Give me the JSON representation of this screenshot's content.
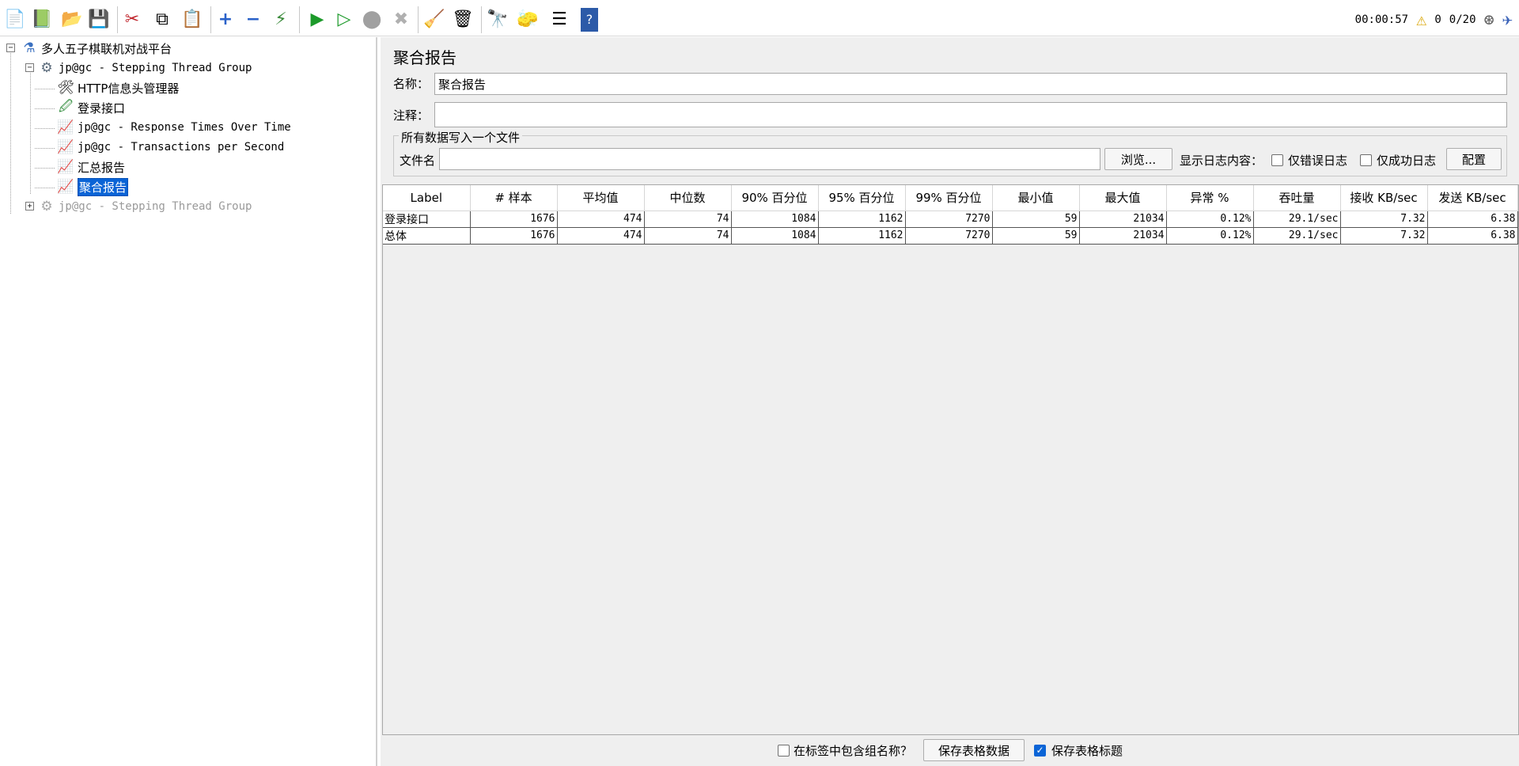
{
  "toolbar": {
    "icons": [
      "new-icon",
      "templates-icon",
      "open-icon",
      "save-icon",
      "cut-icon",
      "copy-icon",
      "paste-icon",
      "expand-icon",
      "collapse-icon",
      "toggle-icon",
      "start-icon",
      "start-no-pauses-icon",
      "stop-icon",
      "shutdown-icon",
      "clear-icon",
      "clear-all-icon",
      "search-icon",
      "reset-search-icon",
      "function-helper-icon",
      "help-icon"
    ],
    "elapsed": "00:00:57",
    "warnings": "0",
    "threads": "0/20"
  },
  "tree": {
    "root": "多人五子棋联机对战平台",
    "group1": "jp@gc - Stepping Thread Group",
    "children": [
      "HTTP信息头管理器",
      "登录接口",
      "jp@gc - Response Times Over Time",
      "jp@gc - Transactions per Second",
      "汇总报告",
      "聚合报告"
    ],
    "group2": "jp@gc - Stepping Thread Group"
  },
  "panel": {
    "title": "聚合报告",
    "name_label": "名称：",
    "name_value": "聚合报告",
    "comment_label": "注释：",
    "comment_value": "",
    "file_section_label": "所有数据写入一个文件",
    "filename_label": "文件名",
    "filename_value": "",
    "browse_label": "浏览...",
    "log_content_label": "显示日志内容：",
    "errors_only_label": "仅错误日志",
    "success_only_label": "仅成功日志",
    "configure_label": "配置"
  },
  "table": {
    "columns": [
      "Label",
      "# 样本",
      "平均值",
      "中位数",
      "90% 百分位",
      "95% 百分位",
      "99% 百分位",
      "最小值",
      "最大值",
      "异常 %",
      "吞吐量",
      "接收 KB/sec",
      "发送 KB/sec"
    ],
    "rows": [
      [
        "登录接口",
        "1676",
        "474",
        "74",
        "1084",
        "1162",
        "7270",
        "59",
        "21034",
        "0.12%",
        "29.1/sec",
        "7.32",
        "6.38"
      ],
      [
        "总体",
        "1676",
        "474",
        "74",
        "1084",
        "1162",
        "7270",
        "59",
        "21034",
        "0.12%",
        "29.1/sec",
        "7.32",
        "6.38"
      ]
    ]
  },
  "bottom": {
    "include_group_label": "在标签中包含组名称？",
    "include_group_checked": false,
    "save_data_label": "保存表格数据",
    "save_header_label": "保存表格标题",
    "save_header_checked": true
  }
}
